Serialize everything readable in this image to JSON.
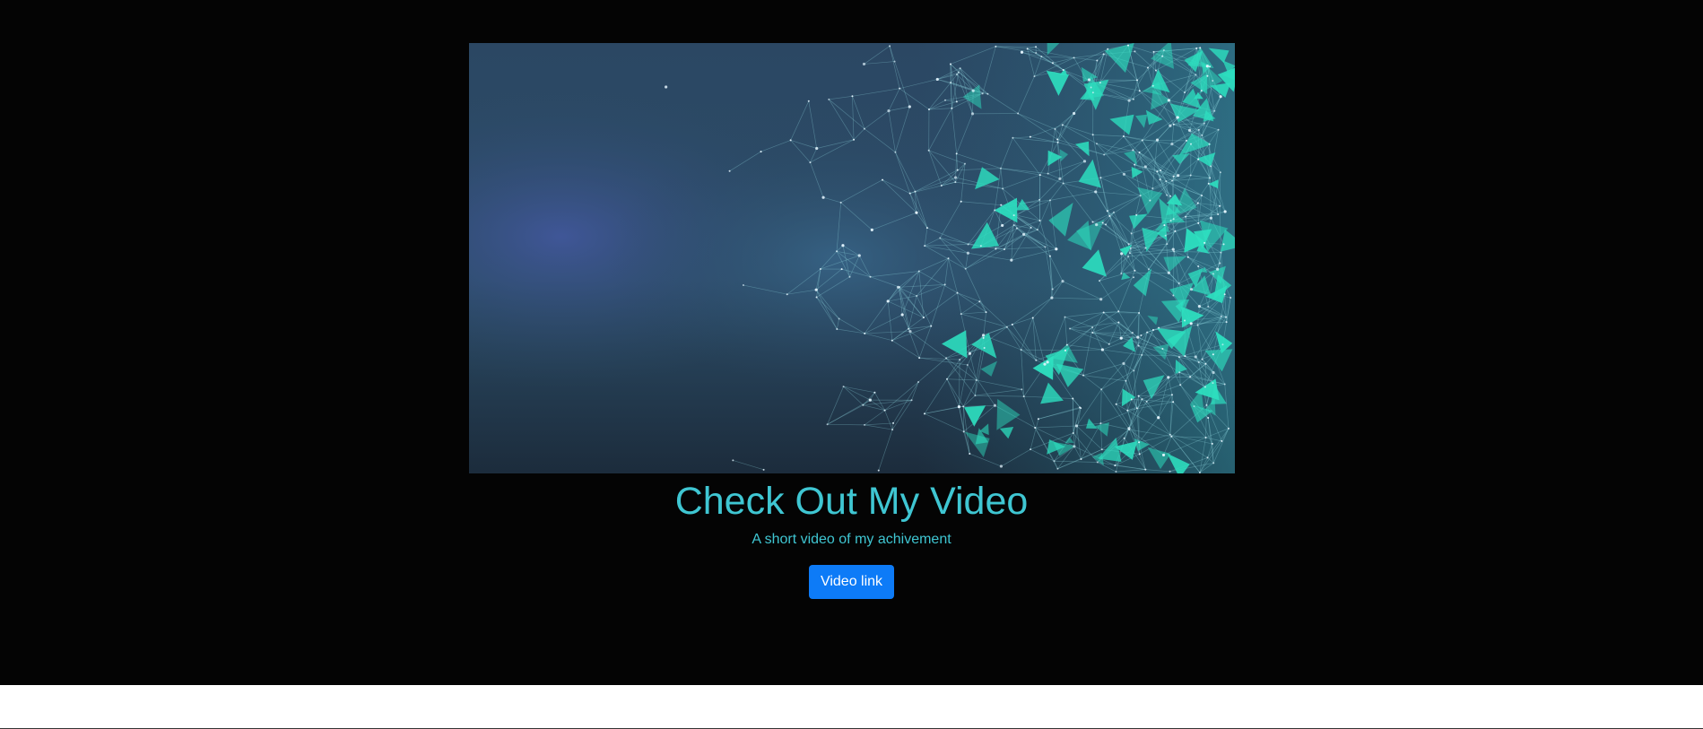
{
  "hero": {
    "title": "Check Out My Video",
    "subtitle": "A short video of my achivement",
    "button_label": "Video link",
    "media": "video-thumbnail-particles"
  },
  "colors": {
    "background": "#040404",
    "accent_text": "#3fc6d2",
    "button": "#0d7bf7",
    "particle": "#2de0c0"
  }
}
